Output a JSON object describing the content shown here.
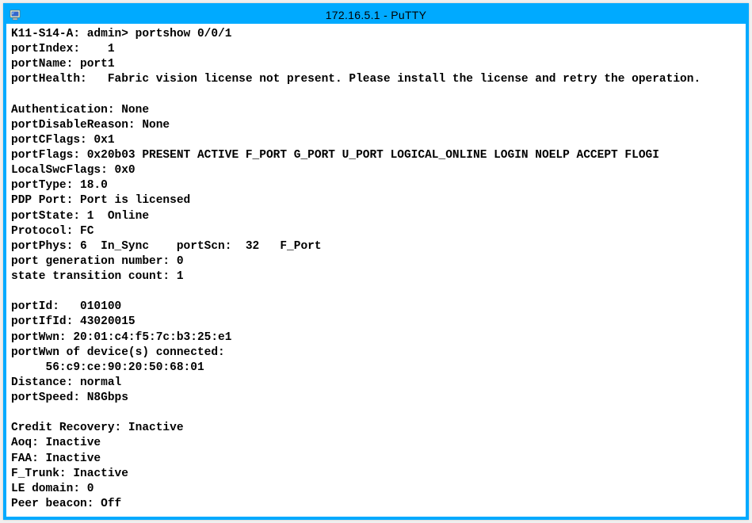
{
  "window": {
    "title": "172.16.5.1 - PuTTY",
    "app_icon": "putty-icon"
  },
  "terminal": {
    "lines": [
      "K11-S14-A: admin> portshow 0/0/1",
      "portIndex:    1",
      "portName: port1",
      "portHealth:   Fabric vision license not present. Please install the license and retry the operation.",
      "",
      "Authentication: None",
      "portDisableReason: None",
      "portCFlags: 0x1",
      "portFlags: 0x20b03 PRESENT ACTIVE F_PORT G_PORT U_PORT LOGICAL_ONLINE LOGIN NOELP ACCEPT FLOGI",
      "LocalSwcFlags: 0x0",
      "portType: 18.0",
      "PDP Port: Port is licensed",
      "portState: 1  Online",
      "Protocol: FC",
      "portPhys: 6  In_Sync    portScn:  32   F_Port",
      "port generation number: 0",
      "state transition count: 1",
      "",
      "portId:   010100",
      "portIfId: 43020015",
      "portWwn: 20:01:c4:f5:7c:b3:25:e1",
      "portWwn of device(s) connected:",
      "     56:c9:ce:90:20:50:68:01",
      "Distance: normal",
      "portSpeed: N8Gbps",
      "",
      "Credit Recovery: Inactive",
      "Aoq: Inactive",
      "FAA: Inactive",
      "F_Trunk: Inactive",
      "LE domain: 0",
      "Peer beacon: Off"
    ]
  }
}
